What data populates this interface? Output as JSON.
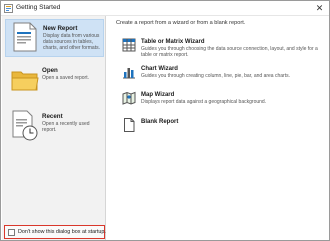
{
  "window": {
    "title": "Getting Started",
    "close_glyph": "✕"
  },
  "sidebar": {
    "items": [
      {
        "title": "New Report",
        "description": "Display data from various data sources in tables, charts, and other formats.",
        "icon": "new-report-icon"
      },
      {
        "title": "Open",
        "description": "Open a saved report.",
        "icon": "folder-icon"
      },
      {
        "title": "Recent",
        "description": "Open a recently used report.",
        "icon": "recent-report-icon"
      }
    ]
  },
  "main": {
    "intro": "Create a report from a wizard or from a blank report.",
    "options": [
      {
        "title": "Table or Matrix Wizard",
        "description": "Guides you through choosing the data source connection, layout, and style for a table or matrix report.",
        "icon": "table-icon"
      },
      {
        "title": "Chart Wizard",
        "description": "Guides you through creating column, line, pie, bar, and area charts.",
        "icon": "chart-icon"
      },
      {
        "title": "Map Wizard",
        "description": "Displays report data against a geographical background.",
        "icon": "map-icon"
      },
      {
        "title": "Blank Report",
        "description": "",
        "icon": "blank-report-icon"
      }
    ]
  },
  "footer": {
    "checkbox_label": "Don't show this dialog box at startup.",
    "checked": false
  },
  "colors": {
    "accent": "#1e73be",
    "selection": "#cfe2f5",
    "highlight_border": "#d9372b"
  }
}
